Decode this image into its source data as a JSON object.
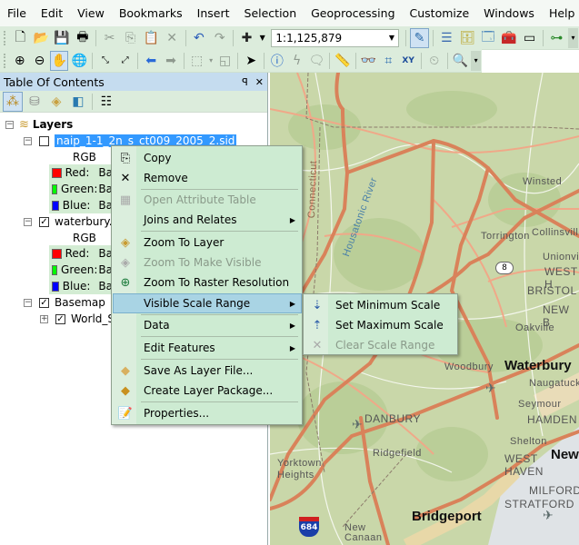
{
  "menubar": {
    "items": [
      "File",
      "Edit",
      "View",
      "Bookmarks",
      "Insert",
      "Selection",
      "Geoprocessing",
      "Customize",
      "Windows",
      "Help"
    ]
  },
  "toolbar1": {
    "icons": [
      "new-document",
      "open-folder",
      "save",
      "print",
      "cut",
      "copy",
      "paste",
      "delete",
      "undo",
      "redo",
      "add-data",
      "add-data-dropdown"
    ],
    "scale_value": "1:1,125,879",
    "right_icons": [
      "editor-toolbar",
      "table-of-contents",
      "catalog",
      "search-window",
      "arctoolbox",
      "python-window",
      "model-builder",
      "toolbar-options"
    ]
  },
  "toolbar2": {
    "icons": [
      "zoom-in",
      "zoom-out",
      "pan",
      "full-extent",
      "fixed-zoom-in",
      "fixed-zoom-out",
      "back-extent",
      "forward-extent",
      "select-features",
      "clear-selection",
      "select-elements",
      "identify",
      "hyperlink",
      "html-popup",
      "measure",
      "find",
      "find-route",
      "go-to-xy",
      "time-slider",
      "magnifier",
      "toolbar-options"
    ]
  },
  "toc": {
    "title": "Table Of Contents",
    "pin": "♂",
    "close": "✕",
    "root": "Layers",
    "layers": [
      {
        "name": "naip_1-1_2n_s_ct009_2005_2.sid",
        "checked": false,
        "selected": true,
        "renderer": "RGB",
        "bands": [
          {
            "label": "Red:",
            "value": "Ba",
            "color": "#ff0000"
          },
          {
            "label": "Green:",
            "value": "Ba",
            "color": "#00ff00"
          },
          {
            "label": "Blue:",
            "value": "Ba",
            "color": "#0000ff"
          }
        ]
      },
      {
        "name": "waterbury.J",
        "checked": true,
        "selected": false,
        "renderer": "RGB",
        "bands": [
          {
            "label": "Red:",
            "value": "Ba",
            "color": "#ff0000"
          },
          {
            "label": "Green:",
            "value": "Ba",
            "color": "#00ff00"
          },
          {
            "label": "Blue:",
            "value": "Ba",
            "color": "#0000ff"
          }
        ]
      },
      {
        "name": "Basemap",
        "checked": true,
        "selected": false,
        "children": [
          {
            "name": "World_S",
            "checked": true
          }
        ]
      }
    ]
  },
  "context_menu": {
    "items": [
      {
        "label": "Copy",
        "icon": "copy",
        "enabled": true
      },
      {
        "label": "Remove",
        "icon": "remove",
        "enabled": true
      },
      {
        "label": "Open Attribute Table",
        "icon": "table",
        "enabled": false
      },
      {
        "label": "Joins and Relates",
        "enabled": true,
        "submenu": true
      },
      {
        "label": "Zoom To Layer",
        "icon": "zoom-to-layer",
        "enabled": true
      },
      {
        "label": "Zoom To Make Visible",
        "icon": "zoom-visible",
        "enabled": false
      },
      {
        "label": "Zoom To Raster Resolution",
        "icon": "zoom-raster",
        "enabled": true
      },
      {
        "label": "Visible Scale Range",
        "enabled": true,
        "submenu": true,
        "highlighted": true
      },
      {
        "label": "Data",
        "enabled": true,
        "submenu": true
      },
      {
        "label": "Edit Features",
        "enabled": true,
        "submenu": true
      },
      {
        "label": "Save As Layer File...",
        "icon": "layer-file",
        "enabled": true
      },
      {
        "label": "Create Layer Package...",
        "icon": "layer-package",
        "enabled": true
      },
      {
        "label": "Properties...",
        "icon": "properties",
        "enabled": true
      }
    ]
  },
  "submenu": {
    "items": [
      {
        "label": "Set Minimum Scale",
        "enabled": true
      },
      {
        "label": "Set Maximum Scale",
        "enabled": true
      },
      {
        "label": "Clear Scale Range",
        "enabled": false
      }
    ]
  },
  "map": {
    "labels": [
      {
        "text": "Winsted",
        "cls": "mid"
      },
      {
        "text": "Torrington",
        "cls": "mid"
      },
      {
        "text": "Collinsville",
        "cls": "mid"
      },
      {
        "text": "Unionville",
        "cls": "mid"
      },
      {
        "text": "WEST H",
        "cls": "mid"
      },
      {
        "text": "BRISTOL",
        "cls": "mid"
      },
      {
        "text": "NEW B",
        "cls": "mid"
      },
      {
        "text": "Oakville",
        "cls": "mid"
      },
      {
        "text": "Waterbury",
        "cls": "big"
      },
      {
        "text": "Naugatuck",
        "cls": "mid"
      },
      {
        "text": "Woodbury",
        "cls": "mid"
      },
      {
        "text": "Seymour",
        "cls": "mid"
      },
      {
        "text": "HAMDEN",
        "cls": "mid"
      },
      {
        "text": "DANBURY",
        "cls": "mid"
      },
      {
        "text": "Shelton",
        "cls": "mid"
      },
      {
        "text": "New",
        "cls": "big"
      },
      {
        "text": "WEST HAVEN",
        "cls": "mid"
      },
      {
        "text": "Ridgefield",
        "cls": "mid"
      },
      {
        "text": "Yorktown Heights",
        "cls": "mid"
      },
      {
        "text": "MILFORD",
        "cls": "mid"
      },
      {
        "text": "STRATFORD",
        "cls": "mid"
      },
      {
        "text": "Bridgeport",
        "cls": "big"
      },
      {
        "text": "New Canaan",
        "cls": "mid"
      },
      {
        "text": "Connecticut",
        "cls": "mid"
      },
      {
        "text": "Housatonic River",
        "cls": "mid"
      }
    ],
    "shields": [
      "8",
      "684"
    ]
  }
}
